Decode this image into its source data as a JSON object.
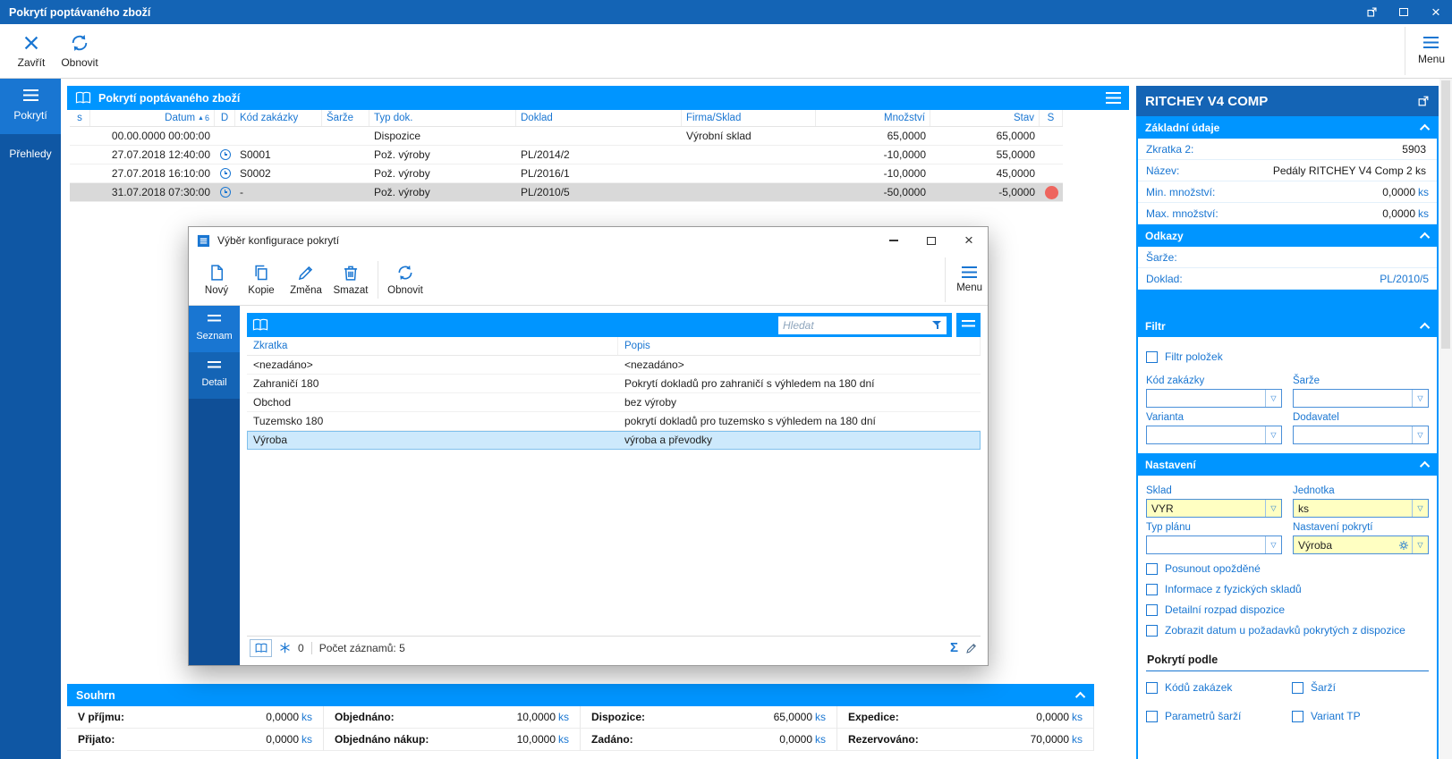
{
  "window": {
    "title": "Pokrytí poptávaného zboží"
  },
  "toolbar": {
    "close": "Zavřít",
    "refresh": "Obnovit",
    "menu": "Menu"
  },
  "sidebar": {
    "items": [
      {
        "label": "Pokrytí"
      },
      {
        "label": "Přehledy"
      }
    ]
  },
  "main": {
    "title": "Pokrytí poptávaného zboží",
    "columns": {
      "s": "s",
      "datum": "Datum",
      "sort": "▲",
      "sort_num": "6",
      "d": "D",
      "kod": "Kód zakázky",
      "sarze": "Šarže",
      "typ": "Typ dok.",
      "doklad": "Doklad",
      "firma": "Firma/Sklad",
      "mnozstvi": "Množství",
      "stav": "Stav",
      "status": "S"
    },
    "rows": [
      {
        "datum": "00.00.0000 00:00:00",
        "kod": "",
        "sarze": "",
        "typ": "Dispozice",
        "doklad": "",
        "firma": "Výrobní sklad",
        "mnozstvi": "65,0000",
        "stav": "65,0000"
      },
      {
        "datum": "27.07.2018 12:40:00",
        "kod": "S0001",
        "sarze": "",
        "typ": "Pož. výroby",
        "doklad": "PL/2014/2",
        "firma": "",
        "mnozstvi": "-10,0000",
        "stav": "55,0000"
      },
      {
        "datum": "27.07.2018 16:10:00",
        "kod": "S0002",
        "sarze": "",
        "typ": "Pož. výroby",
        "doklad": "PL/2016/1",
        "firma": "",
        "mnozstvi": "-10,0000",
        "stav": "45,0000"
      },
      {
        "datum": "31.07.2018 07:30:00",
        "kod": "-",
        "sarze": "",
        "typ": "Pož. výroby",
        "doklad": "PL/2010/5",
        "firma": "",
        "mnozstvi": "-50,0000",
        "stav": "-5,0000"
      }
    ]
  },
  "dialog": {
    "title": "Výběr konfigurace pokrytí",
    "toolbar": {
      "new": "Nový",
      "copy": "Kopie",
      "edit": "Změna",
      "del": "Smazat",
      "refresh": "Obnovit",
      "menu": "Menu"
    },
    "tabs": [
      {
        "label": "Seznam"
      },
      {
        "label": "Detail"
      }
    ],
    "search_placeholder": "Hledat",
    "columns": {
      "zkratka": "Zkratka",
      "popis": "Popis"
    },
    "rows": [
      {
        "zkratka": "<nezadáno>",
        "popis": "<nezadáno>"
      },
      {
        "zkratka": "Zahraničí 180",
        "popis": "Pokrytí dokladů pro zahraničí s výhledem na 180 dní"
      },
      {
        "zkratka": "Obchod",
        "popis": "bez výroby"
      },
      {
        "zkratka": "Tuzemsko 180",
        "popis": "pokrytí dokladů pro tuzemsko s výhledem na 180 dní"
      },
      {
        "zkratka": "Výroba",
        "popis": "výroba a převodky"
      }
    ],
    "statusbar": {
      "frozen": "0",
      "records": "Počet záznamů: 5",
      "sigma": "Σ"
    }
  },
  "summary": {
    "title": "Souhrn",
    "items": [
      {
        "label": "V příjmu:",
        "value": "0,0000",
        "unit": "ks"
      },
      {
        "label": "Objednáno:",
        "value": "10,0000",
        "unit": "ks"
      },
      {
        "label": "Dispozice:",
        "value": "65,0000",
        "unit": "ks"
      },
      {
        "label": "Expedice:",
        "value": "0,0000",
        "unit": "ks"
      },
      {
        "label": "Přijato:",
        "value": "0,0000",
        "unit": "ks"
      },
      {
        "label": "Objednáno nákup:",
        "value": "10,0000",
        "unit": "ks"
      },
      {
        "label": "Zadáno:",
        "value": "0,0000",
        "unit": "ks"
      },
      {
        "label": "Rezervováno:",
        "value": "70,0000",
        "unit": "ks"
      }
    ]
  },
  "detail": {
    "title": "RITCHEY V4 COMP",
    "basic": {
      "header": "Základní údaje",
      "rows": [
        {
          "label": "Zkratka 2:",
          "value": "5903",
          "unit": ""
        },
        {
          "label": "Název:",
          "value": "Pedály RITCHEY V4 Comp 2 ks",
          "unit": ""
        },
        {
          "label": "Min. množství:",
          "value": "0,0000",
          "unit": "ks"
        },
        {
          "label": "Max. množství:",
          "value": "0,0000",
          "unit": "ks"
        }
      ]
    },
    "links": {
      "header": "Odkazy",
      "rows": [
        {
          "label": "Šarže:",
          "value": ""
        },
        {
          "label": "Doklad:",
          "value": "PL/2010/5"
        }
      ]
    },
    "filter": {
      "header": "Filtr",
      "checkbox": "Filtr položek",
      "fields": [
        {
          "label": "Kód zakázky",
          "value": ""
        },
        {
          "label": "Šarže",
          "value": ""
        },
        {
          "label": "Varianta",
          "value": ""
        },
        {
          "label": "Dodavatel",
          "value": ""
        }
      ]
    },
    "settings": {
      "header": "Nastavení",
      "fields": [
        {
          "label": "Sklad",
          "value": "VYR"
        },
        {
          "label": "Jednotka",
          "value": "ks"
        },
        {
          "label": "Typ plánu",
          "value": ""
        },
        {
          "label": "Nastavení pokrytí",
          "value": "Výroba"
        }
      ],
      "checkboxes": [
        {
          "label": "Posunout opožděné"
        },
        {
          "label": "Informace z fyzických skladů"
        },
        {
          "label": "Detailní rozpad dispozice"
        },
        {
          "label": "Zobrazit datum u požadavků pokrytých z dispozice"
        }
      ],
      "coverage_heading": "Pokrytí podle",
      "coverage": [
        {
          "label": "Kódů zakázek"
        },
        {
          "label": "Šarží"
        },
        {
          "label": "Parametrů šarží"
        },
        {
          "label": "Variant TP"
        }
      ]
    }
  }
}
